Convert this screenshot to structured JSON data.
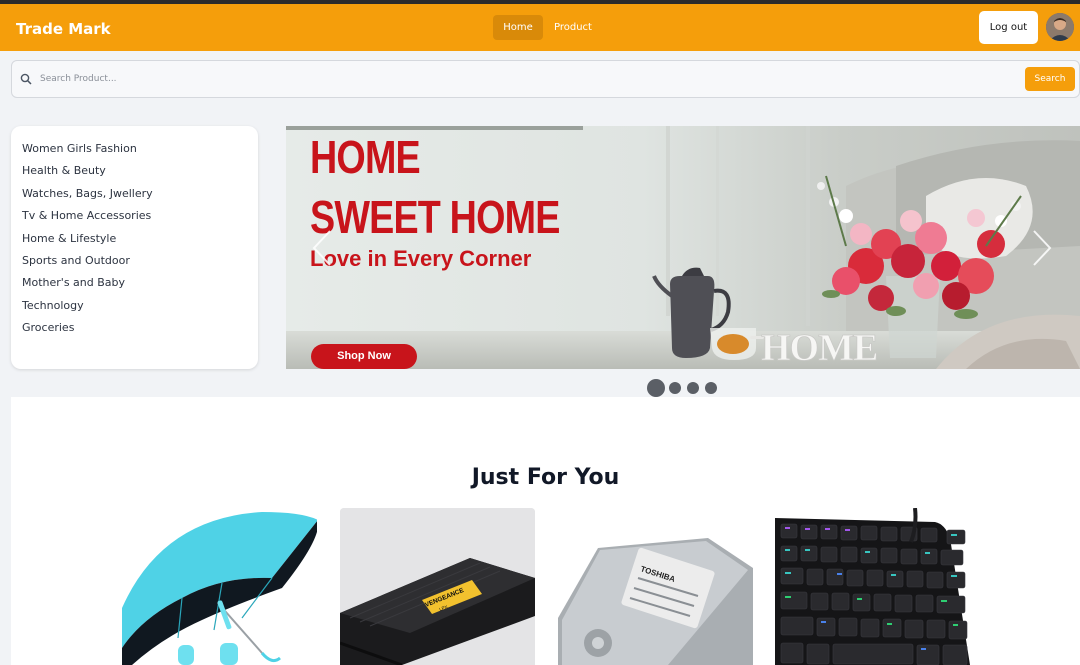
{
  "navbar": {
    "brand": "Trade Mark",
    "links": [
      {
        "label": "Home",
        "active": true
      },
      {
        "label": "Product",
        "active": false
      }
    ],
    "logout_label": "Log out",
    "accent_color": "#f59e0b"
  },
  "search": {
    "placeholder": "Search Product...",
    "button_label": "Search"
  },
  "categories": [
    "Women Girls Fashion",
    "Health & Beuty",
    "Watches, Bags, Jwellery",
    "Tv & Home Accessories",
    "Home & Lifestyle",
    "Sports and Outdoor",
    "Mother's and Baby",
    "Technology",
    "Groceries"
  ],
  "banner": {
    "line1": "HOME",
    "line2": "SWEET HOME",
    "subtitle": "Love in Every Corner",
    "cta": "Shop Now",
    "watermark": "HOME",
    "slide_count": 4,
    "active_slide": 1
  },
  "just_for_you": {
    "title": "Just For You",
    "products": [
      {
        "icon": "umbrella-product-image"
      },
      {
        "icon": "ram-module-product-image",
        "printed_text": [
          "VENGEANCE",
          "LPX"
        ]
      },
      {
        "icon": "hard-drive-product-image",
        "printed_text": [
          "TOSHIBA"
        ]
      },
      {
        "icon": "keyboard-product-image"
      }
    ]
  }
}
